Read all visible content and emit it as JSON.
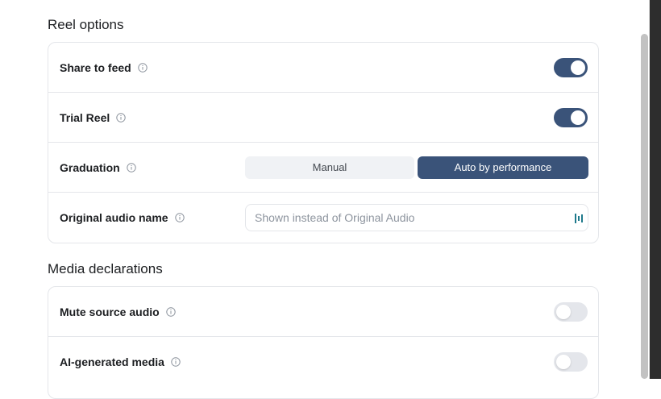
{
  "reel_options": {
    "title": "Reel options",
    "share_to_feed": {
      "label": "Share to feed",
      "enabled": true
    },
    "trial_reel": {
      "label": "Trial Reel",
      "enabled": true
    },
    "graduation": {
      "label": "Graduation",
      "options": [
        "Manual",
        "Auto by performance"
      ],
      "selected": "Auto by performance"
    },
    "original_audio_name": {
      "label": "Original audio name",
      "value": "",
      "placeholder": "Shown instead of Original Audio"
    }
  },
  "media_declarations": {
    "title": "Media declarations",
    "mute_source_audio": {
      "label": "Mute source audio",
      "enabled": false
    },
    "ai_generated_media": {
      "label": "AI-generated media",
      "enabled": false
    }
  },
  "colors": {
    "accent": "#3a5379",
    "toggle_off": "#e4e6eb",
    "border": "#e4e6ea"
  },
  "icons": {
    "info": "info-circle-icon",
    "input_accessory": "waveform-icon"
  }
}
